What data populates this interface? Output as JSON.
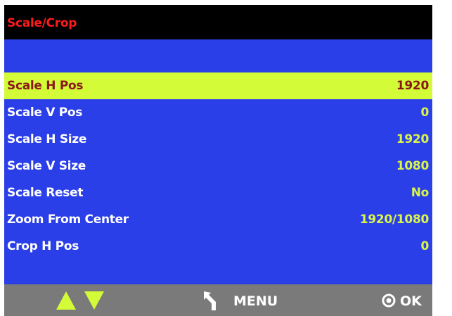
{
  "header": {
    "title": "Scale/Crop"
  },
  "menu": {
    "items": [
      {
        "label": "Scale H Pos",
        "value": "1920",
        "selected": true
      },
      {
        "label": "Scale V Pos",
        "value": "0",
        "selected": false
      },
      {
        "label": "Scale H Size",
        "value": "1920",
        "selected": false
      },
      {
        "label": "Scale V Size",
        "value": "1080",
        "selected": false
      },
      {
        "label": "Scale Reset",
        "value": "No",
        "selected": false
      },
      {
        "label": "Zoom From Center",
        "value": "1920/1080",
        "selected": false
      },
      {
        "label": "Crop H Pos",
        "value": "0",
        "selected": false
      }
    ],
    "more_below_icon": "triangle-down-icon"
  },
  "footer": {
    "nav_icons": [
      "triangle-up-icon",
      "triangle-down-icon"
    ],
    "back_icon": "back-arrow-icon",
    "menu_label": "MENU",
    "ok_icon": "circle-dot-icon",
    "ok_label": "OK"
  },
  "colors": {
    "title_bar_bg": "#000000",
    "title_text": "#ff1a1a",
    "menu_bg": "#2b3fe8",
    "selected_bg": "#d4fb37",
    "selected_text": "#8a1a1a",
    "label_text": "#ffffff",
    "value_text": "#d9f54a",
    "footer_bg": "#7a7a7a"
  }
}
